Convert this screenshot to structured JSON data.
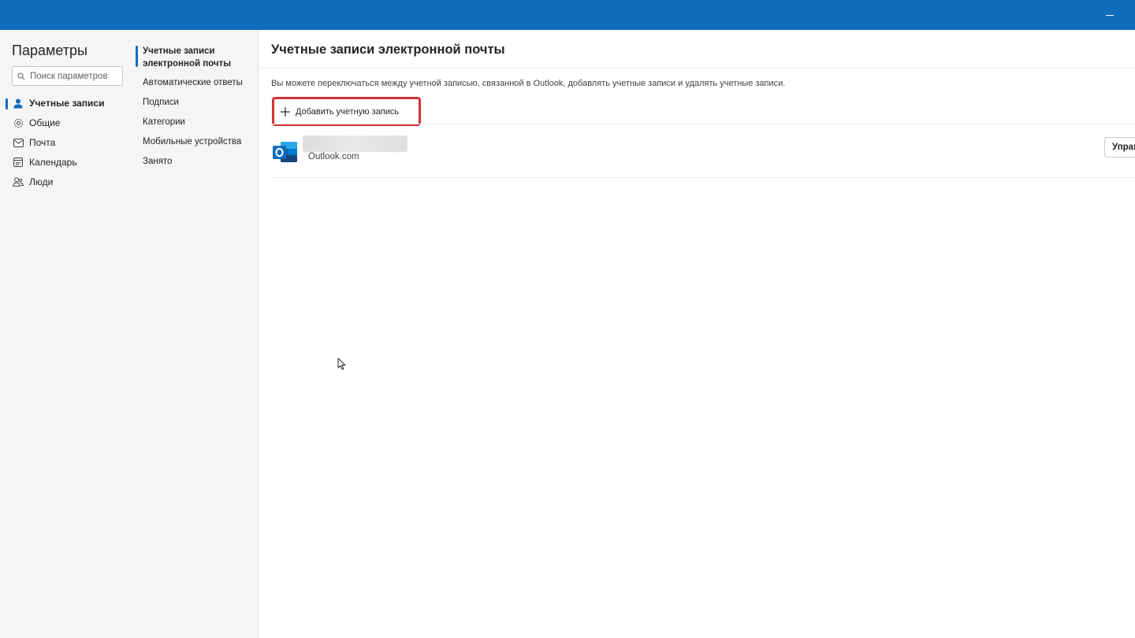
{
  "window": {
    "titlebar_color": "#0f6cbd",
    "minimize_icon": "minimize-icon"
  },
  "sidebar": {
    "title": "Параметры",
    "search": {
      "placeholder": "Поиск параметров",
      "value": "",
      "icon": "search-icon"
    },
    "items": [
      {
        "label": "Учетные записи",
        "icon": "person-icon",
        "active": true
      },
      {
        "label": "Общие",
        "icon": "gear-icon",
        "active": false
      },
      {
        "label": "Почта",
        "icon": "mail-icon",
        "active": false
      },
      {
        "label": "Календарь",
        "icon": "calendar-icon",
        "active": false
      },
      {
        "label": "Люди",
        "icon": "people-icon",
        "active": false
      }
    ]
  },
  "subnav": {
    "items": [
      {
        "label": "Учетные записи электронной почты",
        "active": true
      },
      {
        "label": "Автоматические ответы",
        "active": false
      },
      {
        "label": "Подписи",
        "active": false
      },
      {
        "label": "Категории",
        "active": false
      },
      {
        "label": "Мобильные устройства",
        "active": false
      },
      {
        "label": "Занято",
        "active": false
      }
    ]
  },
  "main": {
    "title": "Учетные записи электронной почты",
    "description": "Вы можете переключаться между учетной записью, связанной в Outlook, добавлять учетные записи и удалять учетные записи.",
    "add_button": {
      "label": "Добавить учетную запись",
      "icon": "plus-icon",
      "highlight_color": "#d13438"
    },
    "accounts": [
      {
        "icon": "outlook-icon",
        "type": "Outlook.com",
        "manage_label": "Управ"
      }
    ]
  }
}
